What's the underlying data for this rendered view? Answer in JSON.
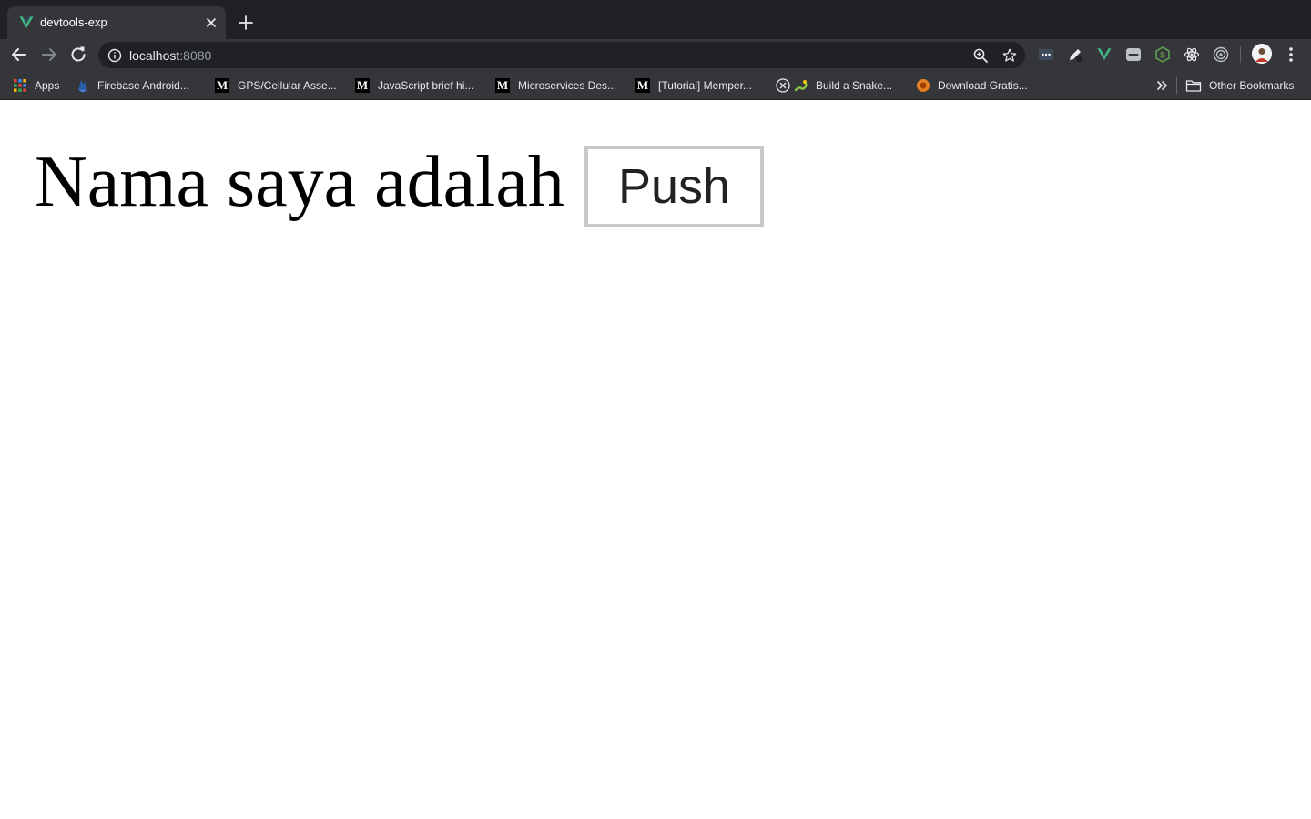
{
  "browser": {
    "tab": {
      "title": "devtools-exp",
      "favicon": "vue-logo-icon"
    },
    "address_bar": {
      "host": "localhost",
      "port": ":8080"
    },
    "extensions": [
      "more-ext-icon",
      "pen-ext-icon",
      "vue-devtools-icon",
      "chat-ext-icon",
      "node-ext-icon",
      "react-devtools-icon",
      "target-ext-icon"
    ],
    "bookmarks": [
      {
        "label": "Apps",
        "icon": "apps-grid-icon"
      },
      {
        "label": "Firebase Android...",
        "icon": "firebase-icon"
      },
      {
        "label": "GPS/Cellular Asse...",
        "icon": "medium-icon"
      },
      {
        "label": "JavaScript brief hi...",
        "icon": "medium-icon"
      },
      {
        "label": "Microservices Des...",
        "icon": "medium-icon"
      },
      {
        "label": "[Tutorial] Memper...",
        "icon": "medium-icon"
      },
      {
        "label": "Build a Snake...",
        "icon": "snake-icon"
      },
      {
        "label": "Download Gratis...",
        "icon": "download-site-icon"
      }
    ],
    "other_bookmarks": "Other Bookmarks"
  },
  "page": {
    "heading": "Nama saya adalah",
    "push_button": "Push"
  }
}
